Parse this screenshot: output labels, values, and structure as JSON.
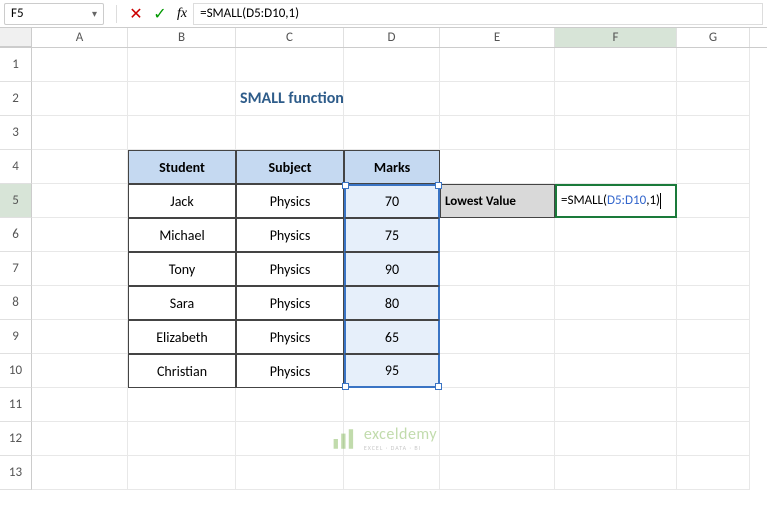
{
  "name_box": "F5",
  "formula_bar": {
    "fx_label": "fx",
    "text": "=SMALL(D5:D10,1)"
  },
  "columns": [
    "A",
    "B",
    "C",
    "D",
    "E",
    "F",
    "G"
  ],
  "row_numbers": [
    "1",
    "2",
    "3",
    "4",
    "5",
    "6",
    "7",
    "8",
    "9",
    "10",
    "11",
    "12",
    "13"
  ],
  "title": "SMALL function",
  "table": {
    "headers": {
      "student": "Student",
      "subject": "Subject",
      "marks": "Marks"
    },
    "rows": [
      {
        "student": "Jack",
        "subject": "Physics",
        "marks": "70"
      },
      {
        "student": "Michael",
        "subject": "Physics",
        "marks": "75"
      },
      {
        "student": "Tony",
        "subject": "Physics",
        "marks": "90"
      },
      {
        "student": "Sara",
        "subject": "Physics",
        "marks": "80"
      },
      {
        "student": "Elizabeth",
        "subject": "Physics",
        "marks": "65"
      },
      {
        "student": "Christian",
        "subject": "Physics",
        "marks": "95"
      }
    ]
  },
  "label_cell": "Lowest Value",
  "active_formula": {
    "prefix": "=SMALL(",
    "ref": "D5:D10",
    "suffix": ",1)"
  },
  "watermark": {
    "brand": "exceldemy",
    "tag": "EXCEL · DATA · BI"
  }
}
